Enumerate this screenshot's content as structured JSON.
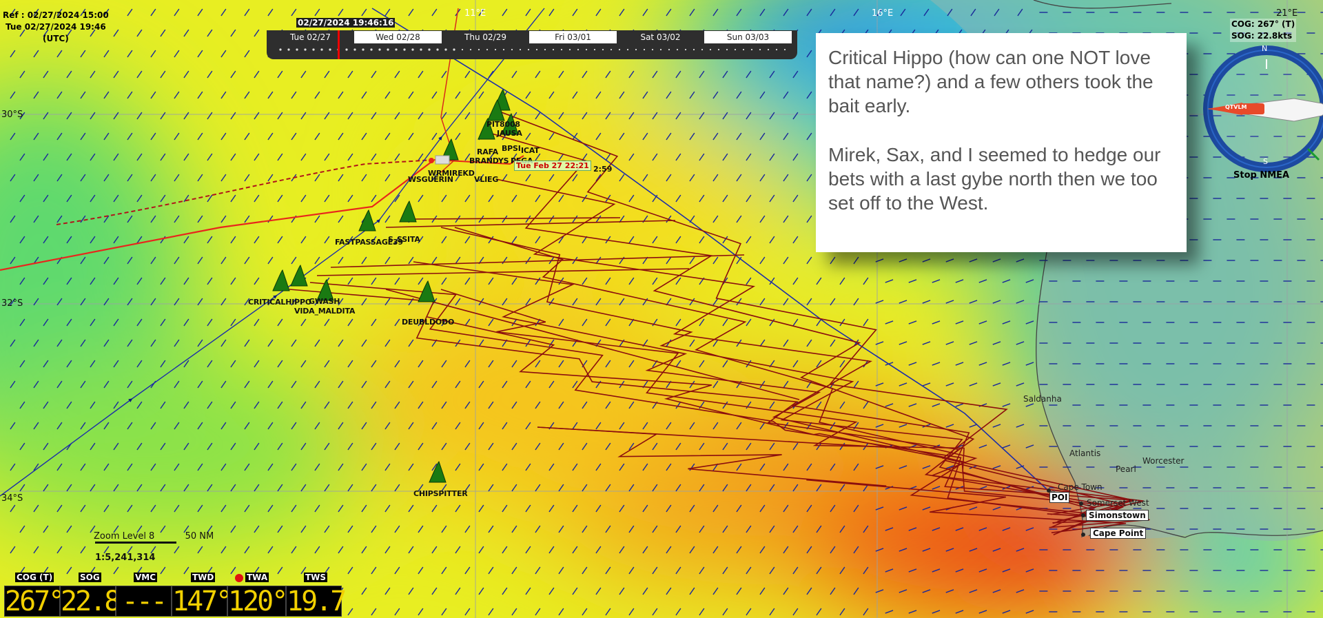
{
  "reference": {
    "ref_line": "Ref : 02/27/2024 15:00",
    "cur_line": "Tue 02/27/2024 19:46",
    "tz_line": "(UTC)"
  },
  "timeline": {
    "current_timestamp": "02/27/2024 19:46:16",
    "days": [
      {
        "label": "Tue 02/27",
        "selected": false
      },
      {
        "label": "Wed 02/28",
        "selected": true
      },
      {
        "label": "Thu 02/29",
        "selected": false
      },
      {
        "label": "Fri 03/01",
        "selected": true
      },
      {
        "label": "Sat 03/02",
        "selected": false
      },
      {
        "label": "Sun 03/03",
        "selected": true
      }
    ]
  },
  "grid": {
    "longitudes": [
      "11°E",
      "16°E",
      "21°E"
    ],
    "latitudes": [
      "30°S",
      "32°S",
      "34°S"
    ]
  },
  "boats": [
    {
      "name": "PIT8008"
    },
    {
      "name": "JAUSA"
    },
    {
      "name": "RAFA"
    },
    {
      "name": "BRANDYS"
    },
    {
      "name": "PEGA"
    },
    {
      "name": "BPSI"
    },
    {
      "name": "ICAT"
    },
    {
      "name": "WRMIREKD"
    },
    {
      "name": "WSGUERIN"
    },
    {
      "name": "VLIEG"
    },
    {
      "name": "FASTPASSAGE39"
    },
    {
      "name": "S_SSITA"
    },
    {
      "name": "CRITICALHIPPO"
    },
    {
      "name": "GWASH"
    },
    {
      "name": "VIDA_MALDITA"
    },
    {
      "name": "DEUBLDODO"
    },
    {
      "name": "CHIPSPITTER"
    }
  ],
  "eta_label": "Tue Feb 27 22:21",
  "eta_suffix": "2:59",
  "poi_label": "POI",
  "cities": [
    {
      "name": "Saldanha"
    },
    {
      "name": "Atlantis"
    },
    {
      "name": "Pearl"
    },
    {
      "name": "Worcester"
    },
    {
      "name": "Cape Town"
    },
    {
      "name": "Somerset West"
    },
    {
      "name": "Simonstown"
    },
    {
      "name": "Cape Point"
    }
  ],
  "note": {
    "para1": "Critical Hippo (how can one NOT love that name?) and a few others took the bait early.",
    "para2": "Mirek, Sax, and I seemed to hedge our bets with a last gybe north then we too set off to the West."
  },
  "compass": {
    "cog": "COG: 267° (T)",
    "sog": "SOG: 22.8kts",
    "boat_label": "QTVLM",
    "stop_button": "Stop NMEA",
    "letters": {
      "n": "N",
      "s": "S"
    }
  },
  "zoom": {
    "level": "Zoom Level 8",
    "scale_nm": "50 NM",
    "ratio": "1:5,241,314"
  },
  "instruments": [
    {
      "label": "COG (T)",
      "value": "267°"
    },
    {
      "label": "SOG",
      "value": "22.8"
    },
    {
      "label": "VMC",
      "value": "----"
    },
    {
      "label": "TWD",
      "value": "147°"
    },
    {
      "label": "TWA",
      "value": "120°"
    },
    {
      "label": "TWS",
      "value": "19.7"
    }
  ],
  "colors": {
    "route_dark": "#8b0e0e",
    "route_red": "#e8261c",
    "route_blue": "#1c2ea8",
    "boat_green": "#1a7a12",
    "instrument_digit": "#f2d000",
    "twa_dot": "#e01010"
  }
}
